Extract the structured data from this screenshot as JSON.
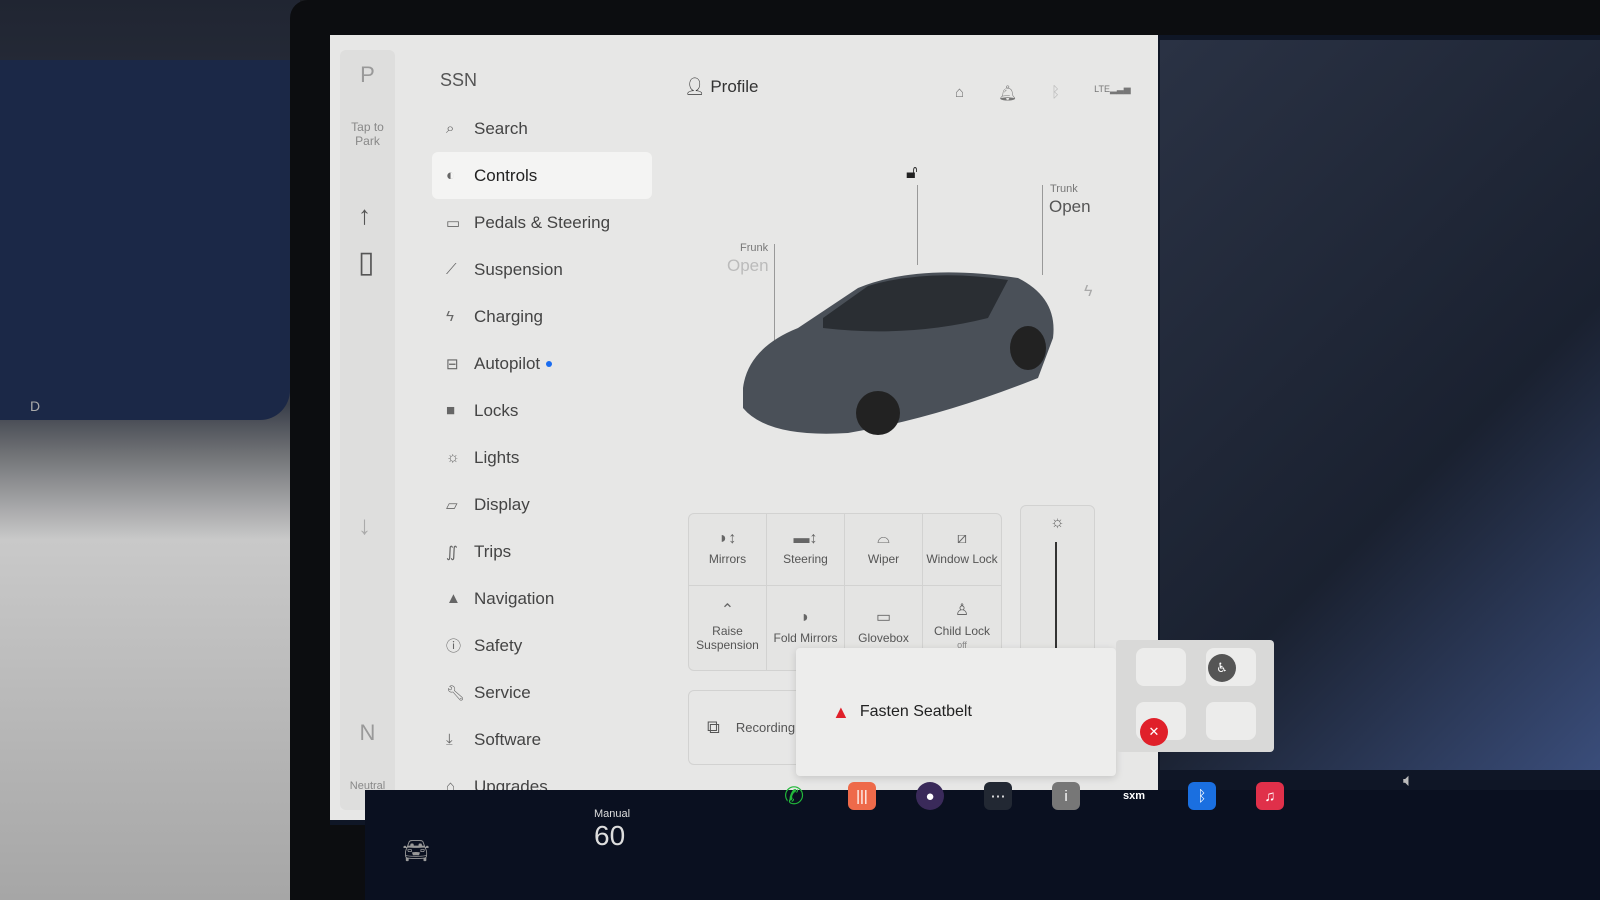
{
  "gear": {
    "park": "P",
    "tap_to_park": "Tap to Park",
    "neutral_letter": "N",
    "neutral_label": "Neutral"
  },
  "cluster": {
    "gear": "D"
  },
  "brand": "SSN",
  "search": {
    "label": "Search"
  },
  "profile": {
    "label": "Profile"
  },
  "status": {
    "network": "LTE"
  },
  "nav": [
    {
      "label": "Controls",
      "icon": "toggle-icon",
      "active": true
    },
    {
      "label": "Pedals & Steering",
      "icon": "car-icon"
    },
    {
      "label": "Suspension",
      "icon": "wrench-icon"
    },
    {
      "label": "Charging",
      "icon": "bolt-icon"
    },
    {
      "label": "Autopilot",
      "icon": "steering-icon",
      "badge": true
    },
    {
      "label": "Locks",
      "icon": "lock-icon"
    },
    {
      "label": "Lights",
      "icon": "light-icon"
    },
    {
      "label": "Display",
      "icon": "display-icon"
    },
    {
      "label": "Trips",
      "icon": "trips-icon"
    },
    {
      "label": "Navigation",
      "icon": "navigation-icon"
    },
    {
      "label": "Safety",
      "icon": "safety-icon"
    },
    {
      "label": "Service",
      "icon": "wrench-icon"
    },
    {
      "label": "Software",
      "icon": "download-icon"
    },
    {
      "label": "Upgrades",
      "icon": "bag-icon"
    }
  ],
  "car": {
    "frunk_label": "Frunk",
    "frunk_state": "Open",
    "trunk_label": "Trunk",
    "trunk_state": "Open"
  },
  "controls": [
    {
      "label": "Mirrors",
      "icon": "mirror-adjust-icon"
    },
    {
      "label": "Steering",
      "icon": "steering-adjust-icon"
    },
    {
      "label": "Wiper",
      "icon": "wiper-icon"
    },
    {
      "label": "Window Lock",
      "icon": "window-lock-icon"
    },
    {
      "label": "Raise Suspension",
      "icon": "suspension-icon"
    },
    {
      "label": "Fold Mirrors",
      "icon": "fold-mirror-icon"
    },
    {
      "label": "Glovebox",
      "icon": "glovebox-icon"
    },
    {
      "label": "Child Lock",
      "sub": "off",
      "icon": "child-lock-icon"
    }
  ],
  "recording": {
    "label": "Recording"
  },
  "alert": {
    "text": "Fasten Seatbelt",
    "color": "#e0202a"
  },
  "climate": {
    "mode": "Manual",
    "temp": "60"
  },
  "dock": [
    {
      "name": "phone",
      "color": "#22b83a"
    },
    {
      "name": "voice",
      "color": "#ee6a4a"
    },
    {
      "name": "camera",
      "color": "#3a2a5a"
    },
    {
      "name": "more",
      "color": "#222833"
    },
    {
      "name": "info",
      "color": "#777"
    },
    {
      "name": "siriusxm",
      "label": "sxm",
      "color": "#0a1020"
    },
    {
      "name": "bluetooth",
      "color": "#1a6fe0"
    },
    {
      "name": "music",
      "color": "#e0304a"
    }
  ]
}
